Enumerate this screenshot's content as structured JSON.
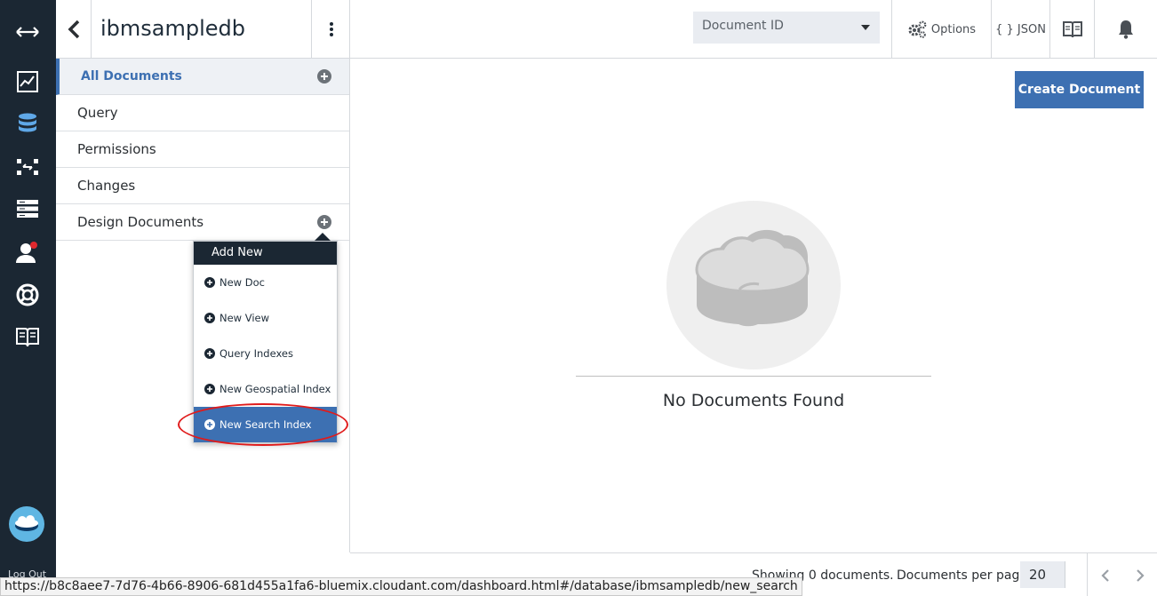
{
  "rail": {
    "icons": [
      "expand-arrows-icon",
      "chart-icon",
      "database-icon",
      "replication-icon",
      "server-icon",
      "account-icon",
      "support-icon",
      "documentation-icon"
    ],
    "logout_label": "Log Out",
    "active_color": "#5fa8e8"
  },
  "header": {
    "db_name": "ibmsampledb"
  },
  "sidebar": {
    "items": [
      {
        "label": "All Documents",
        "active": true
      },
      {
        "label": "Query"
      },
      {
        "label": "Permissions"
      },
      {
        "label": "Changes"
      },
      {
        "label": "Design Documents"
      }
    ]
  },
  "add_menu": {
    "title": "Add New",
    "items": [
      {
        "label": "New Doc"
      },
      {
        "label": "New View"
      },
      {
        "label": "Query Indexes"
      },
      {
        "label": "New Geospatial Index"
      },
      {
        "label": "New Search Index",
        "highlighted": true
      }
    ]
  },
  "toolbar": {
    "doc_id_placeholder": "Document ID",
    "options_label": "Options",
    "json_label": "{ } JSON"
  },
  "main": {
    "create_label": "Create Document",
    "empty_text": "No Documents Found"
  },
  "footer": {
    "showing": "Showing 0 documents.",
    "per_page_label": "Documents per page:",
    "per_page_value": "20"
  },
  "status_bar": {
    "url": "https://b8c8aee7-7d76-4b66-8906-681d455a1fa6-bluemix.cloudant.com/dashboard.html#/database/ibmsampledb/new_search"
  },
  "colors": {
    "accent": "#3d70b2",
    "rail_bg": "#1b2733",
    "highlight_ring": "#e01b1b"
  }
}
